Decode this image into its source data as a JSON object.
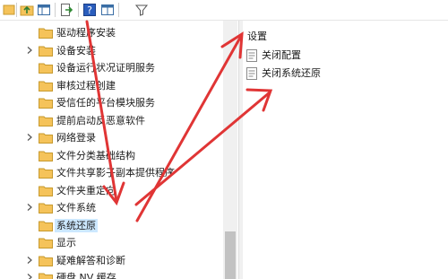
{
  "toolbar": {
    "icons": [
      "back-icon",
      "up-folder-icon",
      "show-hide-tree-icon",
      "export-list-icon",
      "help-icon",
      "properties-icon",
      "filter-icon"
    ]
  },
  "tree": {
    "items": [
      {
        "label": "驱动程序安装",
        "expandable": false
      },
      {
        "label": "设备安装",
        "expandable": true
      },
      {
        "label": "设备运行状况证明服务",
        "expandable": false
      },
      {
        "label": "审核过程创建",
        "expandable": false
      },
      {
        "label": "受信任的平台模块服务",
        "expandable": false
      },
      {
        "label": "提前启动反恶意软件",
        "expandable": false
      },
      {
        "label": "网络登录",
        "expandable": true
      },
      {
        "label": "文件分类基础结构",
        "expandable": false
      },
      {
        "label": "文件共享影子副本提供程序",
        "expandable": false
      },
      {
        "label": "文件夹重定向",
        "expandable": false
      },
      {
        "label": "文件系统",
        "expandable": true
      },
      {
        "label": "系统还原",
        "expandable": false,
        "selected": true
      },
      {
        "label": "显示",
        "expandable": false
      },
      {
        "label": "疑难解答和诊断",
        "expandable": true
      },
      {
        "label": "硬盘 NV 缓存",
        "expandable": true
      }
    ]
  },
  "right": {
    "title": "设置",
    "settings": [
      {
        "label": "关闭配置"
      },
      {
        "label": "关闭系统还原"
      }
    ]
  },
  "colors": {
    "folder": "#f5c35a",
    "selection": "#cce8ff",
    "arrow": "#e03535"
  }
}
